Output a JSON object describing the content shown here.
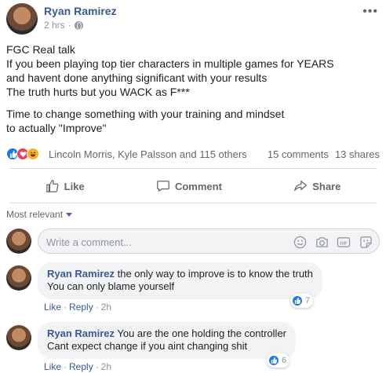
{
  "post": {
    "author": "Ryan Ramirez",
    "timestamp": "2 hrs",
    "privacy_icon": "globe-icon",
    "paragraphs": [
      "FGC Real talk\nIf you been playing top tier characters in multiple games for YEARS\nand havent done anything significant with your results\nThe truth hurts but you WACK as F***",
      "Time to change something with your training and mindset\nto actually \"Improve\""
    ]
  },
  "reactions": {
    "icons": [
      "like-icon",
      "love-icon",
      "haha-icon"
    ],
    "reactors_text": "Lincoln Morris, Kyle Palsson and 115 others",
    "comments_count": "15 comments",
    "shares_count": "13 shares"
  },
  "actions": {
    "like_label": "Like",
    "comment_label": "Comment",
    "share_label": "Share"
  },
  "sort_label": "Most relevant",
  "composer": {
    "placeholder": "Write a comment...",
    "icons": [
      "emoji-icon",
      "camera-icon",
      "gif-icon",
      "sticker-icon"
    ],
    "gif_text": "GIF"
  },
  "comments": [
    {
      "author": "Ryan Ramirez",
      "text": "the only way to improve is to know the truth\nYou can only blame yourself",
      "like_label": "Like",
      "reply_label": "Reply",
      "time": "2h",
      "reaction_count": "7"
    },
    {
      "author": "Ryan Ramirez",
      "text": "You are the one holding the controller\nCant expect change if you aint changing shit",
      "like_label": "Like",
      "reply_label": "Reply",
      "time": "2h",
      "reaction_count": "6"
    }
  ],
  "colors": {
    "link": "#385898",
    "muted": "#90949c",
    "like_blue": "#1877f2",
    "love_red": "#f33e58",
    "haha_yellow": "#f7b125"
  }
}
